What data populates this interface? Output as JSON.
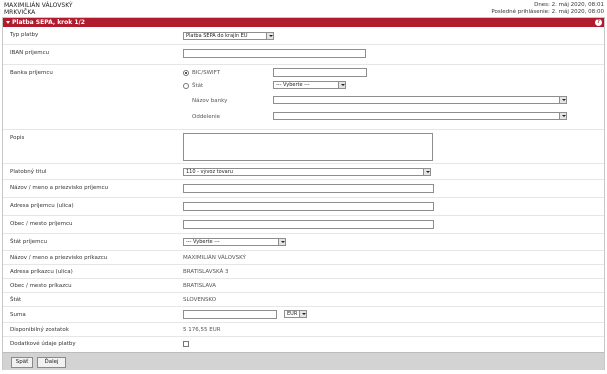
{
  "header": {
    "user_line1": "MAXIMILIÁN VÁLOVSKÝ",
    "user_line2": "MRKVIČKA",
    "right_line1": "Dnes: 2. máj 2020, 08:01",
    "right_line2": "Posledné prihlásenie: 2. máj 2020, 08:00"
  },
  "panel": {
    "title": "Platba SEPA, krok 1/2",
    "help_label": "?"
  },
  "form": {
    "typ_platby": {
      "label": "Typ platby",
      "value": "Platba SEPA do krajín EÚ"
    },
    "iban": {
      "label": "IBAN príjemcu"
    },
    "banka": {
      "label": "Banka príjemcu",
      "option_bic": "BIC/SWIFT",
      "option_stat": "Štát",
      "stat_value": "--- Vyberte ---",
      "nazov_label": "Názov banky",
      "odkelenie_label": "Oddelenie"
    },
    "popis": {
      "label": "Popis"
    },
    "platobny_titul": {
      "label": "Platobný titul",
      "value": "110 - vývoz tovaru"
    },
    "nazov_prijemcu": {
      "label": "Názov / meno a priezvisko príjemcu"
    },
    "adresa_prijemcu": {
      "label": "Adresa príjemcu (ulica)"
    },
    "obec_prijemcu": {
      "label": "Obec / mesto príjemcu"
    },
    "stat_prijemcu": {
      "label": "Štát príjemcu",
      "value": "--- Vyberte ---"
    },
    "nazov_prikazcu": {
      "label": "Názov / meno a priezvisko príkazcu",
      "value": "MAXIMILIÁN VÁLOVSKÝ"
    },
    "adresa_prikazcu": {
      "label": "Adresa príkazcu (ulica)",
      "value": "BRATISLAVSKÁ 3"
    },
    "obec_prikazcu": {
      "label": "Obec / mesto príkazcu",
      "value": "BRATISLAVA"
    },
    "stat": {
      "label": "Štát",
      "value": "SLOVENSKO"
    },
    "suma": {
      "label": "Suma",
      "currency": "EUR"
    },
    "zostatok": {
      "label": "Disponibilný zostatok",
      "value": "5 176,55 EUR"
    },
    "dodatkove": {
      "label": "Dodatkové údaje platby"
    }
  },
  "buttons": {
    "back": "Späť",
    "next": "Ďalej"
  }
}
